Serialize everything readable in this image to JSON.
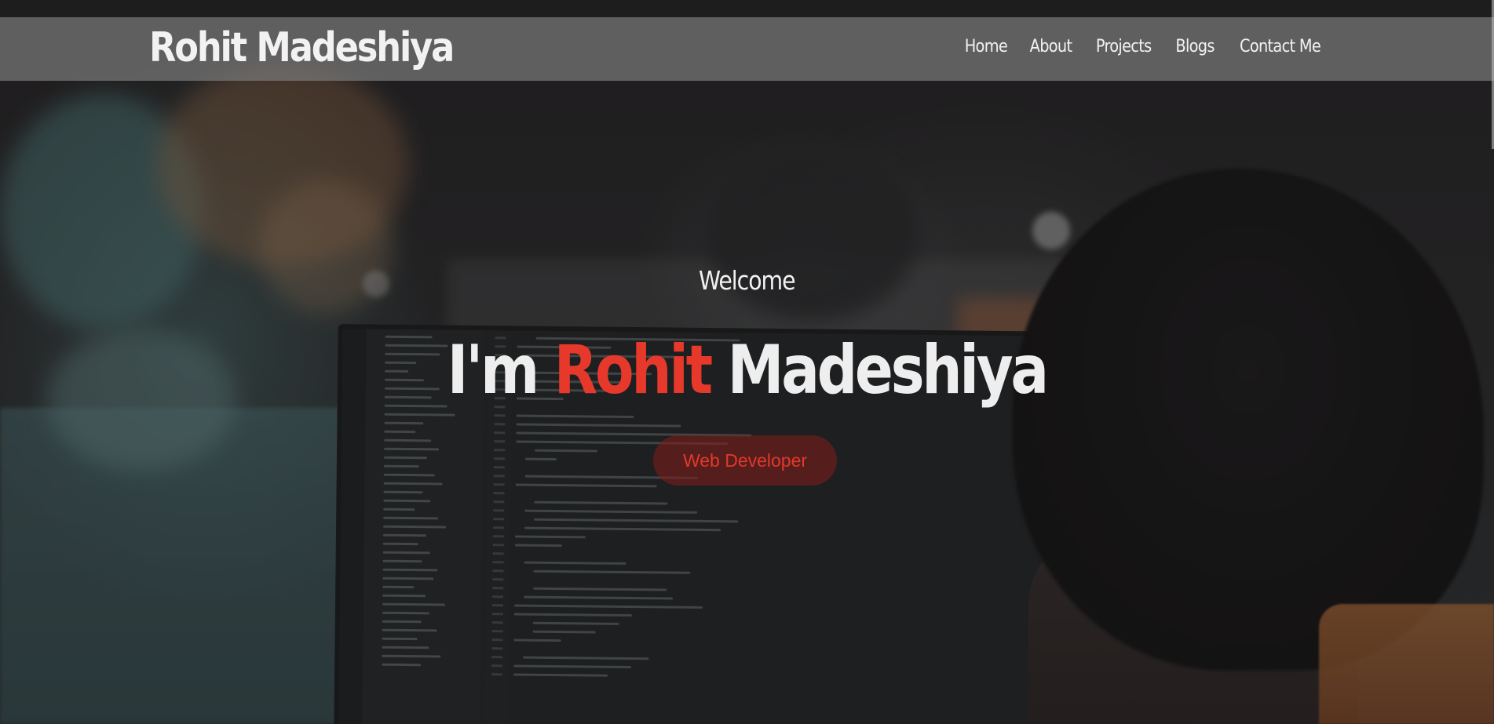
{
  "site": {
    "brand": "Rohit Madeshiya"
  },
  "nav": {
    "items": [
      {
        "label": "Home"
      },
      {
        "label": "About"
      },
      {
        "label": "Projects"
      },
      {
        "label": "Blogs"
      },
      {
        "label": "Contact Me"
      }
    ]
  },
  "hero": {
    "welcome": "Welcome",
    "intro_prefix": "I'm",
    "first_name": "Rohit",
    "last_name": "Madeshiya",
    "role": "Web Developer"
  },
  "colors": {
    "accent": "#e7392b",
    "navbar_bg": "#787878",
    "text": "#f2f2f2"
  }
}
